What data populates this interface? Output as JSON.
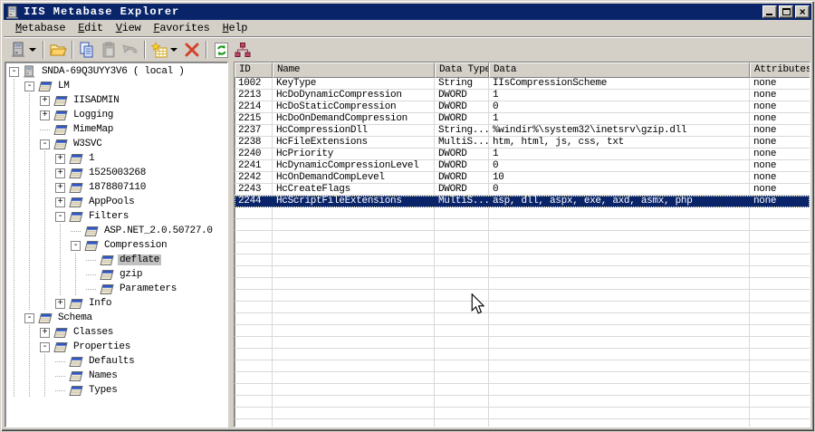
{
  "window": {
    "title": "IIS Metabase Explorer"
  },
  "titlebar": {
    "controls": [
      "minimize",
      "maximize",
      "close"
    ],
    "close_glyph": "×"
  },
  "menu": {
    "items": [
      {
        "label": "Metabase"
      },
      {
        "label": "Edit"
      },
      {
        "label": "View"
      },
      {
        "label": "Favorites"
      },
      {
        "label": "Help"
      }
    ]
  },
  "toolbar": {
    "buttons": [
      {
        "name": "connect-server",
        "icon": "server-icon",
        "has_dropdown": true,
        "disabled": false
      },
      {
        "name": "open",
        "icon": "open-folder-icon",
        "disabled": false
      },
      {
        "name": "copy",
        "icon": "copy-icon",
        "disabled": false
      },
      {
        "name": "paste",
        "icon": "paste-icon",
        "disabled": true
      },
      {
        "name": "undo",
        "icon": "undo-icon",
        "disabled": true
      },
      {
        "name": "new-key",
        "icon": "new-key-icon",
        "has_dropdown": true,
        "disabled": false
      },
      {
        "name": "delete",
        "icon": "delete-x-icon",
        "disabled": false
      },
      {
        "name": "refresh",
        "icon": "refresh-icon",
        "disabled": false
      },
      {
        "name": "view-hierarchy",
        "icon": "hierarchy-icon",
        "disabled": false
      }
    ]
  },
  "tree": {
    "items": [
      {
        "label": "SNDA-69Q3UYY3V6 ( local )",
        "depth": 0,
        "expander": "minus",
        "icon": "computer",
        "selected": false
      },
      {
        "label": "LM",
        "depth": 1,
        "expander": "minus",
        "icon": "key",
        "selected": false
      },
      {
        "label": "IISADMIN",
        "depth": 2,
        "expander": "plus",
        "icon": "key",
        "selected": false
      },
      {
        "label": "Logging",
        "depth": 2,
        "expander": "plus",
        "icon": "key",
        "selected": false
      },
      {
        "label": "MimeMap",
        "depth": 2,
        "expander": null,
        "icon": "key",
        "selected": false
      },
      {
        "label": "W3SVC",
        "depth": 2,
        "expander": "minus",
        "icon": "key",
        "selected": false
      },
      {
        "label": "1",
        "depth": 3,
        "expander": "plus",
        "icon": "key",
        "selected": false
      },
      {
        "label": "1525003268",
        "depth": 3,
        "expander": "plus",
        "icon": "key",
        "selected": false
      },
      {
        "label": "1878807110",
        "depth": 3,
        "expander": "plus",
        "icon": "key",
        "selected": false
      },
      {
        "label": "AppPools",
        "depth": 3,
        "expander": "plus",
        "icon": "key",
        "selected": false
      },
      {
        "label": "Filters",
        "depth": 3,
        "expander": "minus",
        "icon": "key",
        "selected": false
      },
      {
        "label": "ASP.NET_2.0.50727.0",
        "depth": 4,
        "expander": null,
        "icon": "key",
        "selected": false
      },
      {
        "label": "Compression",
        "depth": 4,
        "expander": "minus",
        "icon": "key",
        "selected": false
      },
      {
        "label": "deflate",
        "depth": 5,
        "expander": null,
        "icon": "key",
        "selected": true
      },
      {
        "label": "gzip",
        "depth": 5,
        "expander": null,
        "icon": "key",
        "selected": false
      },
      {
        "label": "Parameters",
        "depth": 5,
        "expander": null,
        "icon": "key",
        "selected": false
      },
      {
        "label": "Info",
        "depth": 3,
        "expander": "plus",
        "icon": "key",
        "selected": false
      },
      {
        "label": "Schema",
        "depth": 1,
        "expander": "minus",
        "icon": "key",
        "selected": false
      },
      {
        "label": "Classes",
        "depth": 2,
        "expander": "plus",
        "icon": "key",
        "selected": false
      },
      {
        "label": "Properties",
        "depth": 2,
        "expander": "minus",
        "icon": "key",
        "selected": false
      },
      {
        "label": "Defaults",
        "depth": 3,
        "expander": null,
        "icon": "key",
        "selected": false
      },
      {
        "label": "Names",
        "depth": 3,
        "expander": null,
        "icon": "key",
        "selected": false
      },
      {
        "label": "Types",
        "depth": 3,
        "expander": null,
        "icon": "key",
        "selected": false
      }
    ]
  },
  "list": {
    "columns": [
      "ID",
      "Name",
      "Data Type",
      "Data",
      "Attributes"
    ],
    "selected_row_index": 10,
    "rows": [
      [
        "1002",
        "KeyType",
        "String",
        "IIsCompressionScheme",
        "none"
      ],
      [
        "2213",
        "HcDoDynamicCompression",
        "DWORD",
        "1",
        "none"
      ],
      [
        "2214",
        "HcDoStaticCompression",
        "DWORD",
        "0",
        "none"
      ],
      [
        "2215",
        "HcDoOnDemandCompression",
        "DWORD",
        "1",
        "none"
      ],
      [
        "2237",
        "HcCompressionDll",
        "String...",
        "%windir%\\system32\\inetsrv\\gzip.dll",
        "none"
      ],
      [
        "2238",
        "HcFileExtensions",
        "MultiS...",
        "htm, html, js, css, txt",
        "none"
      ],
      [
        "2240",
        "HcPriority",
        "DWORD",
        "1",
        "none"
      ],
      [
        "2241",
        "HcDynamicCompressionLevel",
        "DWORD",
        "0",
        "none"
      ],
      [
        "2242",
        "HcOnDemandCompLevel",
        "DWORD",
        "10",
        "none"
      ],
      [
        "2243",
        "HcCreateFlags",
        "DWORD",
        "0",
        "none"
      ],
      [
        "2244",
        "HcScriptFileExtensions",
        "MultiS...",
        "asp, dll, aspx, exe, axd, asmx, php",
        "none"
      ]
    ]
  },
  "colors": {
    "titlebar": "#0a246a",
    "selection": "#0a246a",
    "chrome": "#d4d0c8",
    "tree_selection": "#c0c0c0",
    "grid_line": "#d9d9d9"
  }
}
